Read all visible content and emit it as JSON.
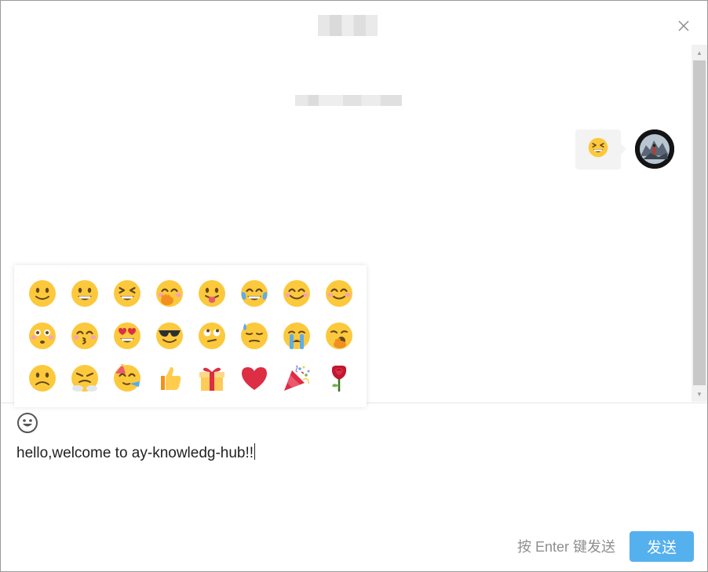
{
  "message": {
    "emoji_name": "grinning-squinting-face"
  },
  "emoji_panel": {
    "rows": [
      [
        "slightly-smiling-face",
        "grinning-face",
        "grinning-squinting-face",
        "face-with-hand-over-mouth",
        "face-with-tongue",
        "face-with-tears-of-joy",
        "smiling-face-with-smiling-eyes",
        "smiling-face"
      ],
      [
        "flushed-face",
        "kissing-face-with-closed-eyes",
        "smiling-face-with-heart-eyes",
        "smiling-face-with-sunglasses",
        "face-with-rolling-eyes",
        "downcast-face-with-sweat",
        "loudly-crying-face",
        "yawning-face"
      ],
      [
        "slightly-frowning-face",
        "face-with-steam-from-nose",
        "partying-face",
        "thumbs-up",
        "wrapped-gift",
        "red-heart",
        "party-popper",
        "rose"
      ]
    ]
  },
  "composer": {
    "text": "hello,welcome to ay-knowledg-hub!!",
    "emoji_toggle_icon": "smiley-icon"
  },
  "footer": {
    "hint": "按 Enter 键发送",
    "send_label": "发送"
  },
  "colors": {
    "send_button": "#55b0ee",
    "emoji_yellow": "#fcc93d",
    "bubble_bg": "#f3f3f3"
  }
}
